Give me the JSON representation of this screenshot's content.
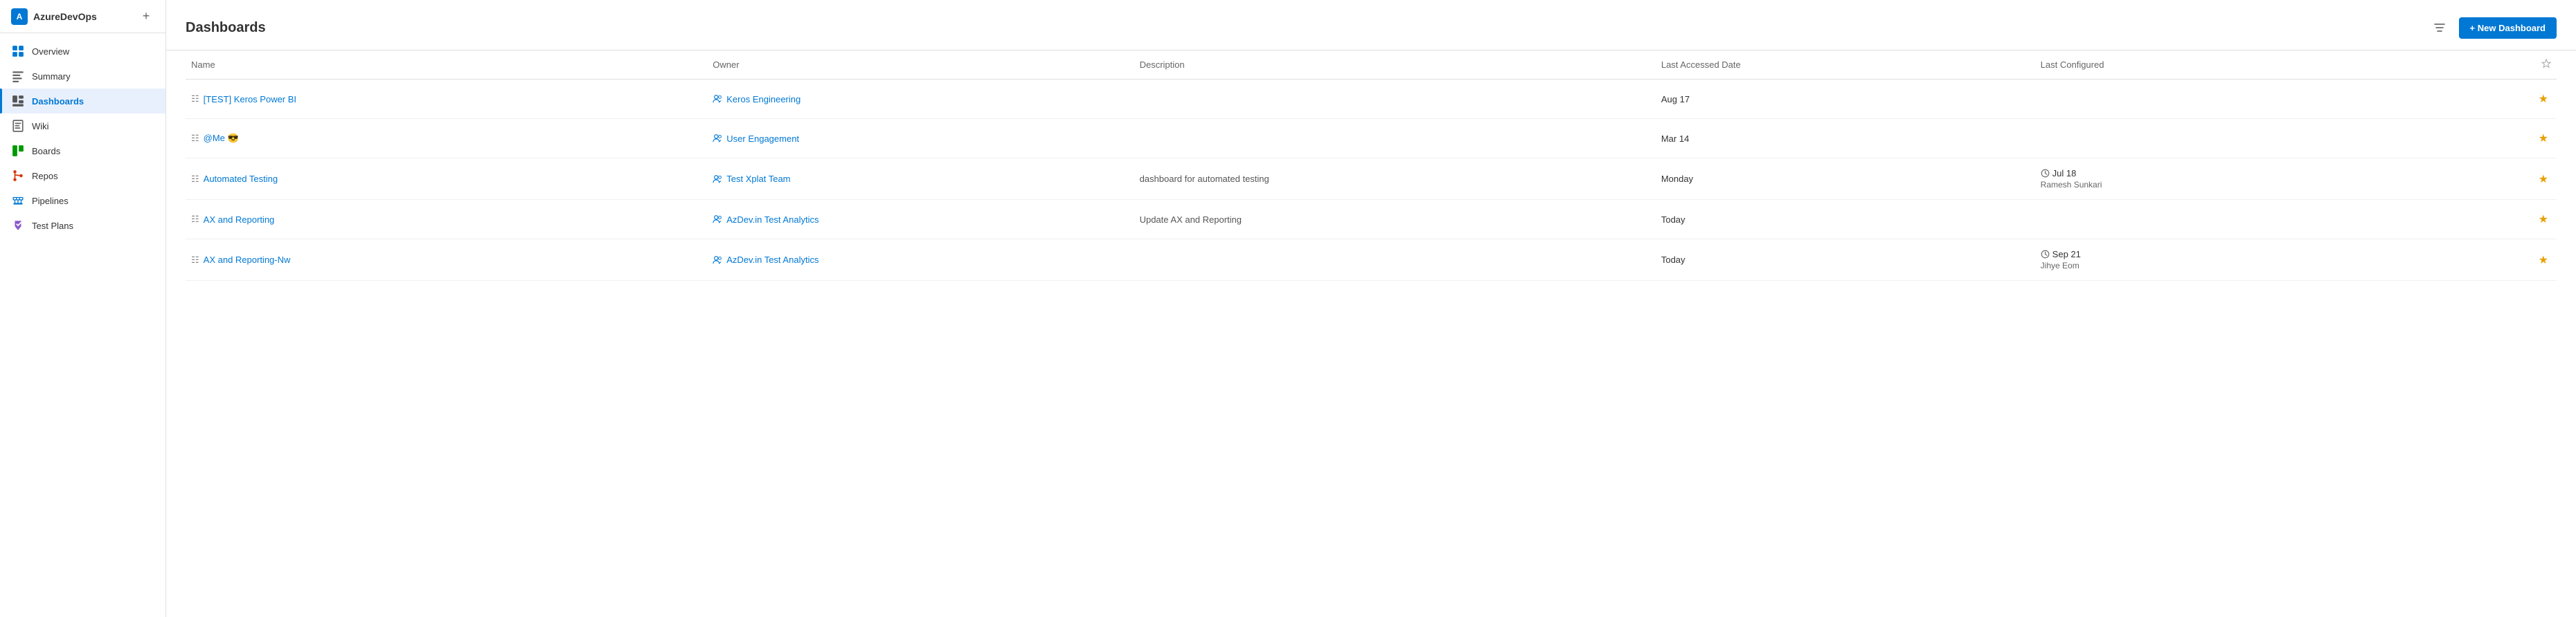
{
  "app": {
    "name": "AzureDevOps",
    "add_label": "+"
  },
  "sidebar": {
    "items": [
      {
        "id": "overview",
        "label": "Overview",
        "icon": "overview",
        "active": false
      },
      {
        "id": "summary",
        "label": "Summary",
        "icon": "summary",
        "active": false
      },
      {
        "id": "dashboards",
        "label": "Dashboards",
        "icon": "dashboards",
        "active": true
      },
      {
        "id": "wiki",
        "label": "Wiki",
        "icon": "wiki",
        "active": false
      },
      {
        "id": "boards",
        "label": "Boards",
        "icon": "boards",
        "active": false
      },
      {
        "id": "repos",
        "label": "Repos",
        "icon": "repos",
        "active": false
      },
      {
        "id": "pipelines",
        "label": "Pipelines",
        "icon": "pipelines",
        "active": false
      },
      {
        "id": "test-plans",
        "label": "Test Plans",
        "icon": "test",
        "active": false
      }
    ]
  },
  "page": {
    "title": "Dashboards",
    "new_dashboard_label": "+ New Dashboard"
  },
  "table": {
    "columns": {
      "name": "Name",
      "owner": "Owner",
      "description": "Description",
      "last_accessed": "Last Accessed Date",
      "last_configured": "Last Configured"
    },
    "rows": [
      {
        "name": "[TEST] Keros Power BI",
        "owner": "Keros Engineering",
        "description": "",
        "last_accessed": "Aug 17",
        "last_configured_date": "",
        "last_configured_user": "",
        "starred": true
      },
      {
        "name": "@Me 😎",
        "owner": "User Engagement",
        "description": "",
        "last_accessed": "Mar 14",
        "last_configured_date": "",
        "last_configured_user": "",
        "starred": true
      },
      {
        "name": "Automated Testing",
        "owner": "Test Xplat Team",
        "description": "dashboard for automated testing",
        "last_accessed": "Monday",
        "last_configured_date": "Jul 18",
        "last_configured_user": "Ramesh Sunkari",
        "starred": true
      },
      {
        "name": "AX and Reporting",
        "owner": "AzDev.in Test Analytics",
        "description": "Update AX and Reporting",
        "last_accessed": "Today",
        "last_configured_date": "",
        "last_configured_user": "",
        "starred": true
      },
      {
        "name": "AX and Reporting-Nw",
        "owner": "AzDev.in Test Analytics",
        "description": "",
        "last_accessed": "Today",
        "last_configured_date": "Sep 21",
        "last_configured_user": "Jihye Eom",
        "starred": true
      }
    ]
  }
}
